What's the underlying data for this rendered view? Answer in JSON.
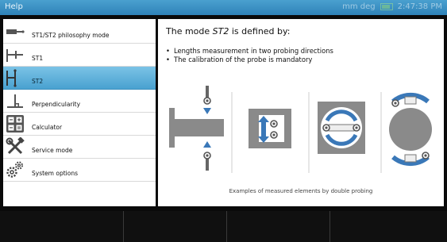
{
  "topbar": {
    "title": "Help",
    "units": "mm deg",
    "time": "2:47:38 PM"
  },
  "sidebar": {
    "items": [
      {
        "label": "ST1/ST2 philosophy mode",
        "icon": "probe-tip-icon",
        "selected": false
      },
      {
        "label": "ST1",
        "icon": "st1-probe-icon",
        "selected": false
      },
      {
        "label": "ST2",
        "icon": "st2-probe-icon",
        "selected": true
      },
      {
        "label": "Perpendicularity",
        "icon": "perpendicularity-icon",
        "selected": false
      },
      {
        "label": "Calculator",
        "icon": "calculator-icon",
        "selected": false
      },
      {
        "label": "Service mode",
        "icon": "tools-icon",
        "selected": false
      },
      {
        "label": "System options",
        "icon": "gears-icon",
        "selected": false
      }
    ]
  },
  "content": {
    "heading_prefix": "The mode ",
    "heading_mode": "ST2",
    "heading_suffix": " is defined by:",
    "bullets": [
      "Lengths measurement in two probing directions",
      "The calibration of the probe is mandatory"
    ],
    "caption": "Examples of measured elements by double probing"
  },
  "colors": {
    "accent": "#49a1d0",
    "titlebar": "#2f82b8",
    "background": "#0a0a0a",
    "shape_gray": "#8a8a8a"
  }
}
